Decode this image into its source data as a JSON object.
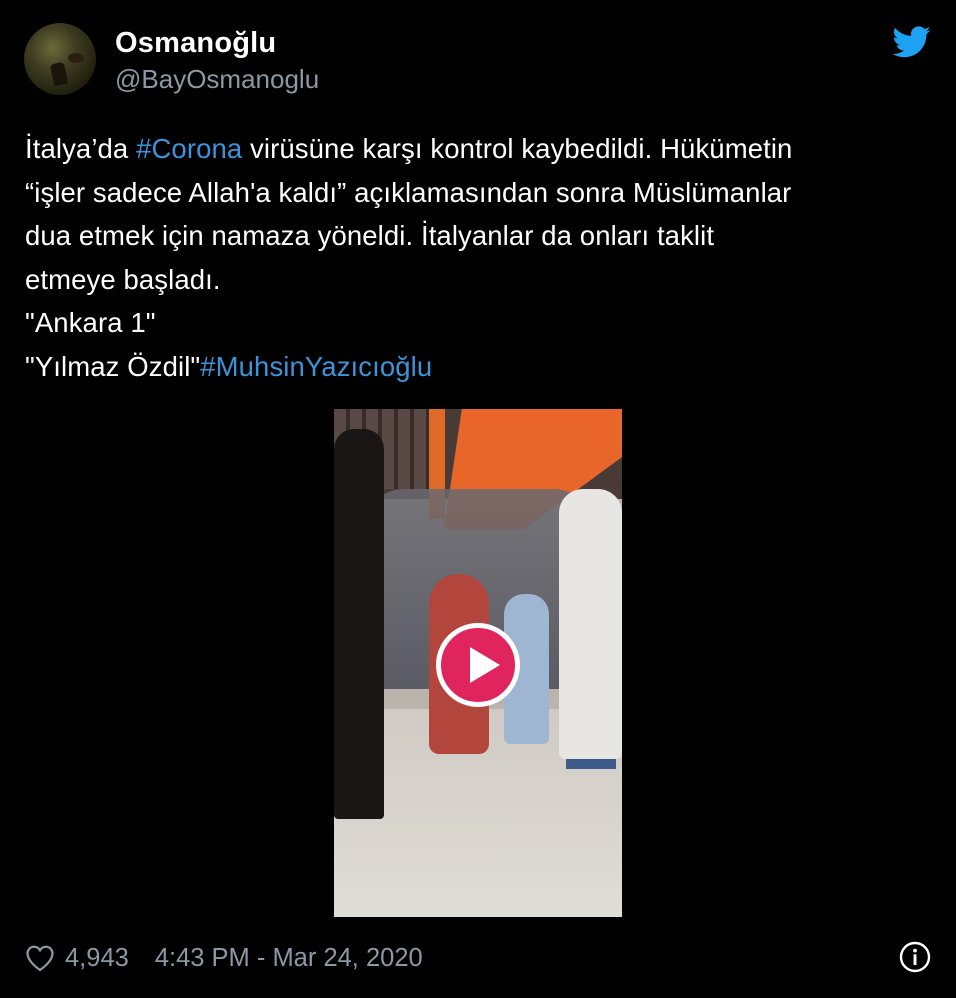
{
  "user": {
    "name": "Osmanoğlu",
    "handle": "@BayOsmanoglu"
  },
  "tweet": {
    "lines": [
      [
        {
          "text": "İtalya’da "
        },
        {
          "text": "#Corona",
          "hashtag": true
        },
        {
          "text": " virüsüne karşı kontrol kaybedildi. Hükümetin"
        }
      ],
      [
        {
          "text": "“işler sadece Allah'a kaldı” açıklamasından sonra Müslümanlar"
        }
      ],
      [
        {
          "text": "dua etmek için namaza yöneldi. İtalyanlar da onları taklit"
        }
      ],
      [
        {
          "text": "etmeye başladı."
        }
      ],
      [
        {
          "text": "\"Ankara 1\""
        }
      ],
      [
        {
          "text": "\"Yılmaz Özdil\""
        },
        {
          "text": "#MuhsinYazıcıoğlu",
          "hashtag": true
        }
      ]
    ]
  },
  "footer": {
    "likes": "4,943",
    "timestamp": "4:43 PM - Mar 24, 2020"
  },
  "icons": {
    "twitter": "twitter-bird-icon",
    "heart": "heart-icon",
    "info": "info-icon",
    "play": "play-icon"
  },
  "colors": {
    "background": "#000000",
    "text": "#ffffff",
    "secondary": "#8b98a5",
    "hashtag": "#3b94d9",
    "twitter_blue": "#1da1f2",
    "play_button": "#e0245e"
  }
}
